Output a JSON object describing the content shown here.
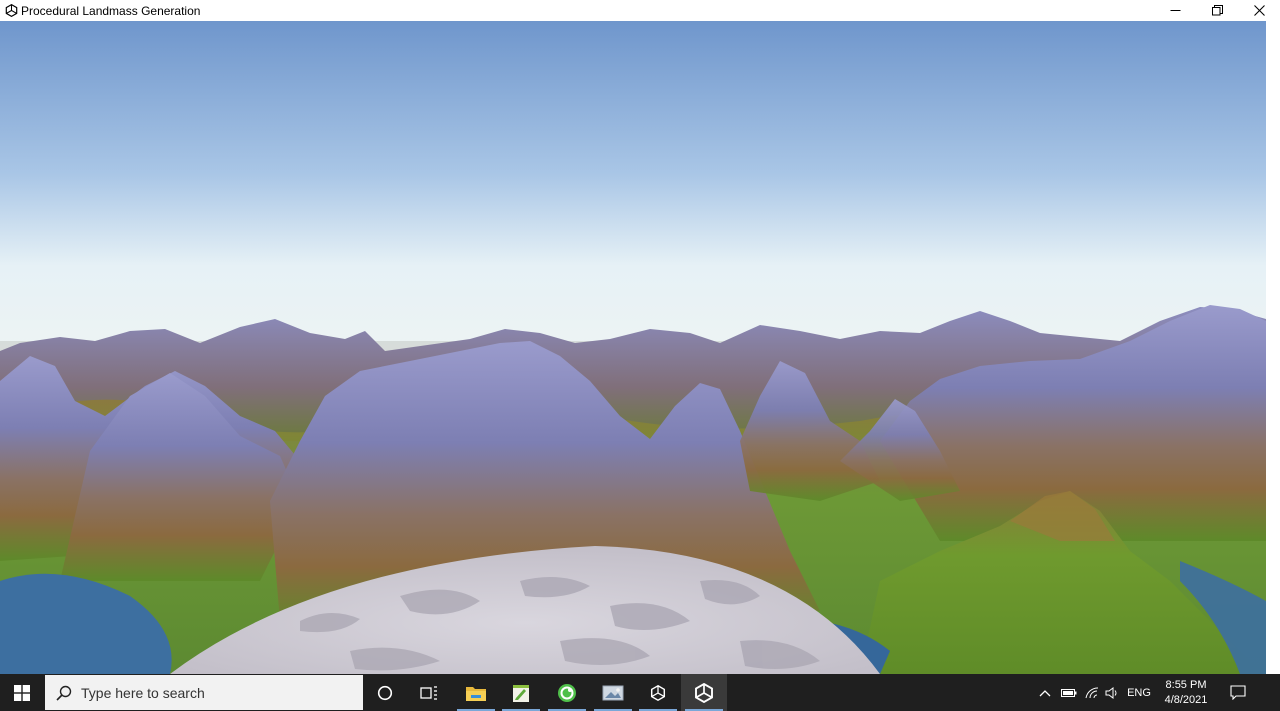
{
  "window": {
    "title": "Procedural Landmass Generation"
  },
  "taskbar": {
    "search_placeholder": "Type here to search",
    "pinned": [
      {
        "name": "cortana",
        "icon": "cortana-circle-icon"
      },
      {
        "name": "task-view",
        "icon": "task-view-icon"
      },
      {
        "name": "file-explorer",
        "icon": "folder-icon"
      },
      {
        "name": "notepad-plus-plus",
        "icon": "notepad-icon"
      },
      {
        "name": "gitkraken",
        "icon": "green-circle-app-icon"
      },
      {
        "name": "photos",
        "icon": "picture-icon"
      },
      {
        "name": "visual-studio",
        "icon": "unity-small-icon"
      },
      {
        "name": "unity",
        "icon": "unity-icon"
      }
    ],
    "tray": {
      "language": "ENG",
      "time": "8:55 PM",
      "date": "4/8/2021"
    }
  },
  "colors": {
    "sky_top": "#6f96cc",
    "sky_horizon": "#e6f1f6",
    "mountain": "#8384b8",
    "grass": "#6e9a2c",
    "water": "#3f78a8",
    "taskbar": "#1f1f1f"
  }
}
